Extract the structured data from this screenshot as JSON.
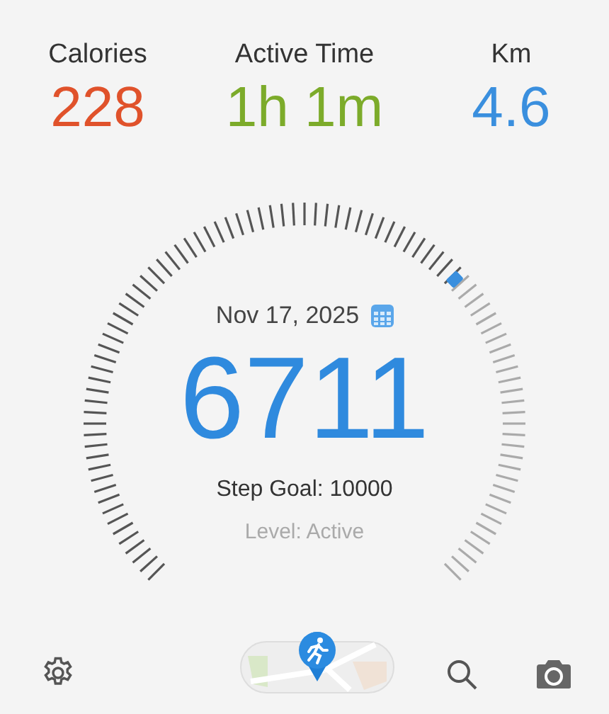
{
  "stats": [
    {
      "label": "Calories",
      "value": "228",
      "color": "#e0522b"
    },
    {
      "label": "Active Time",
      "value": "1h 1m",
      "color": "#7cab2a"
    },
    {
      "label": "Km",
      "value": "4.6",
      "color": "#3a8fde"
    }
  ],
  "gauge": {
    "date": "Nov 17, 2025",
    "steps": "6711",
    "goal": "Step Goal: 10000",
    "activity": "Level: Active"
  }
}
